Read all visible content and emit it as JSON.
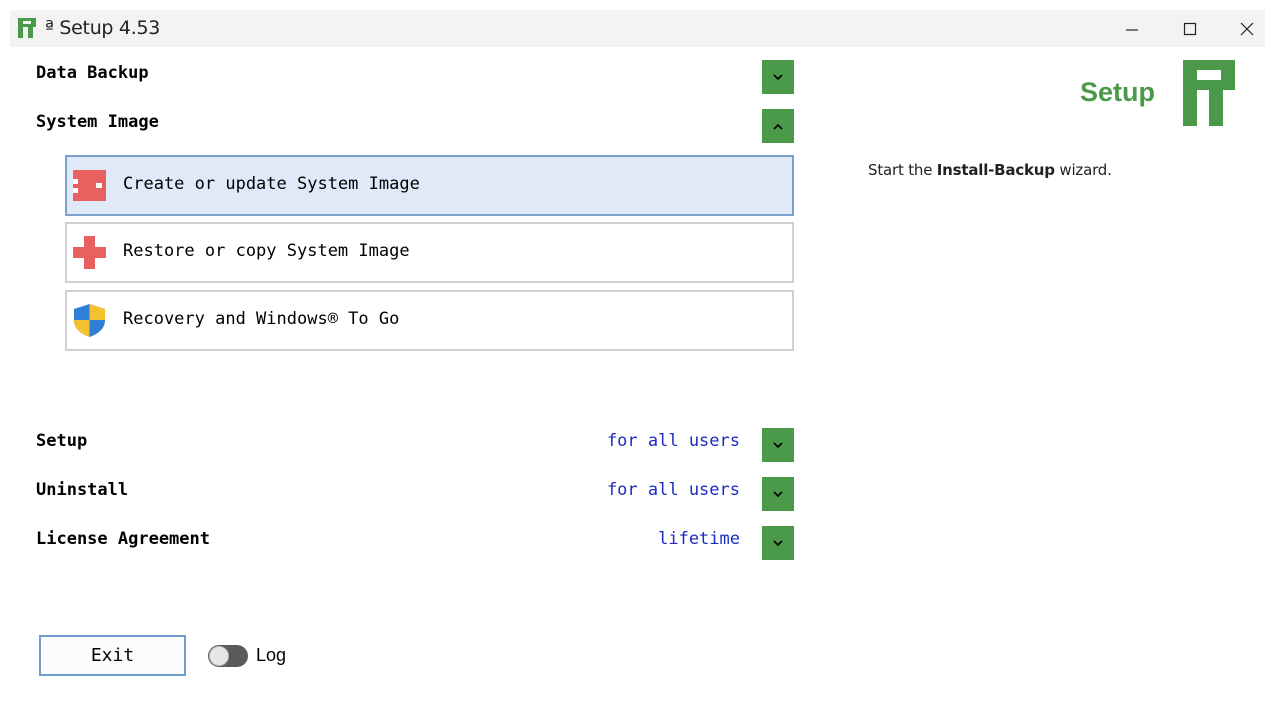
{
  "window": {
    "title": "ª Setup 4.53",
    "controls": {
      "minimize": "minimize-icon",
      "maximize": "maximize-icon",
      "close": "close-icon"
    }
  },
  "colors": {
    "accent": "#4a9a4a",
    "link": "#1a2cbf",
    "selected_bg": "#dfe9f7",
    "selected_border": "#7aa0cc"
  },
  "sections": {
    "data_backup": {
      "label": "Data Backup",
      "state": "collapsed",
      "icon": "chevron-down-icon"
    },
    "system_image": {
      "label": "System Image",
      "state": "expanded",
      "icon": "chevron-up-icon",
      "items": [
        {
          "label": "Create or update System Image",
          "icon": "create-image-icon",
          "selected": true
        },
        {
          "label": "Restore or copy System Image",
          "icon": "restore-cross-icon",
          "selected": false
        },
        {
          "label": "Recovery and Windows® To Go",
          "icon": "shield-icon",
          "selected": false
        }
      ]
    },
    "setup": {
      "label": "Setup",
      "value": "for all users",
      "icon": "chevron-down-icon"
    },
    "uninstall": {
      "label": "Uninstall",
      "value": "for all users",
      "icon": "chevron-down-icon"
    },
    "license": {
      "label": "License Agreement",
      "value": "lifetime",
      "icon": "chevron-down-icon"
    }
  },
  "brand": {
    "text": "Setup"
  },
  "description": {
    "prefix": "Start the ",
    "bold": "Install-Backup",
    "suffix": " wizard."
  },
  "footer": {
    "exit_label": "Exit",
    "log_label": "Log",
    "log_enabled": false
  }
}
